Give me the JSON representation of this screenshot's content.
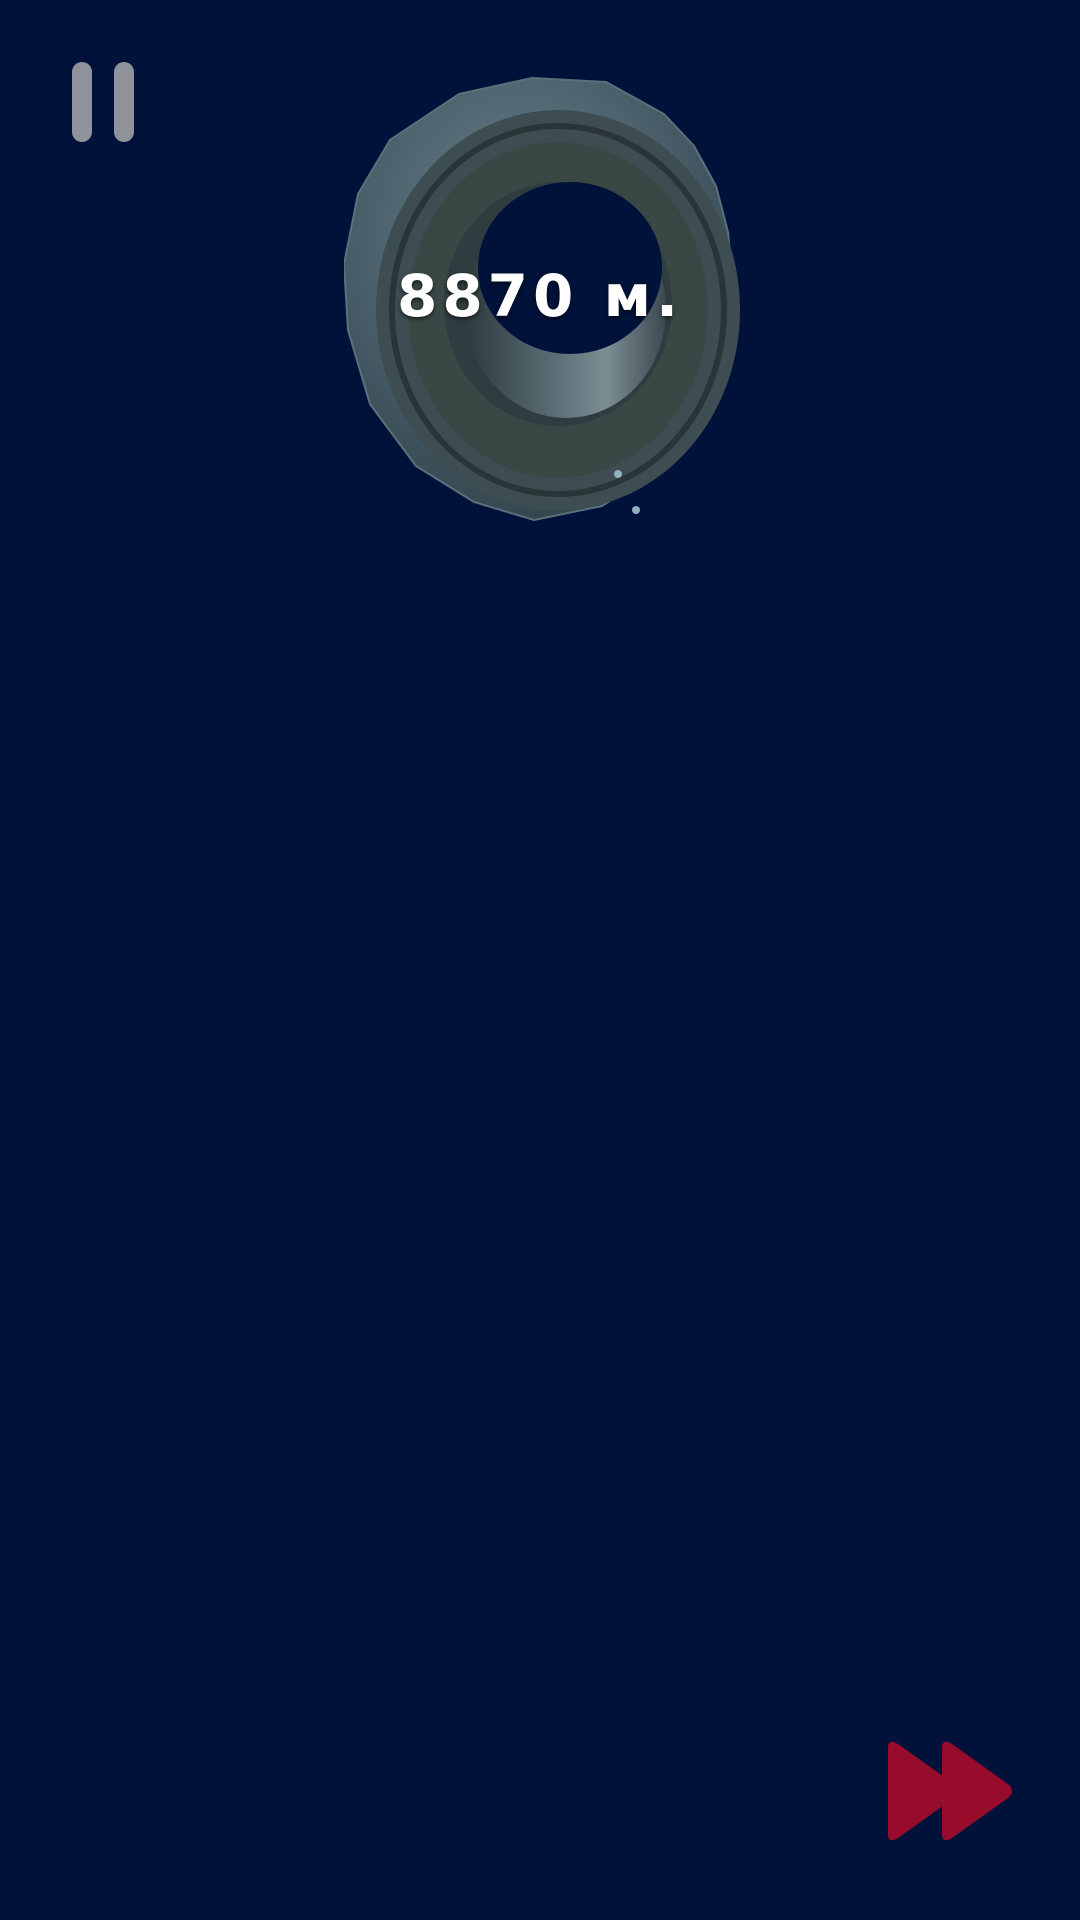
{
  "hud": {
    "distance_label": "8870 м.",
    "pause_icon": "pause-icon",
    "fast_forward_icon": "fast-forward-icon"
  },
  "scene": {
    "object": "tire",
    "background_color": "#00123a",
    "pause_color": "#8f929b",
    "fast_forward_color": "#960c2a"
  }
}
